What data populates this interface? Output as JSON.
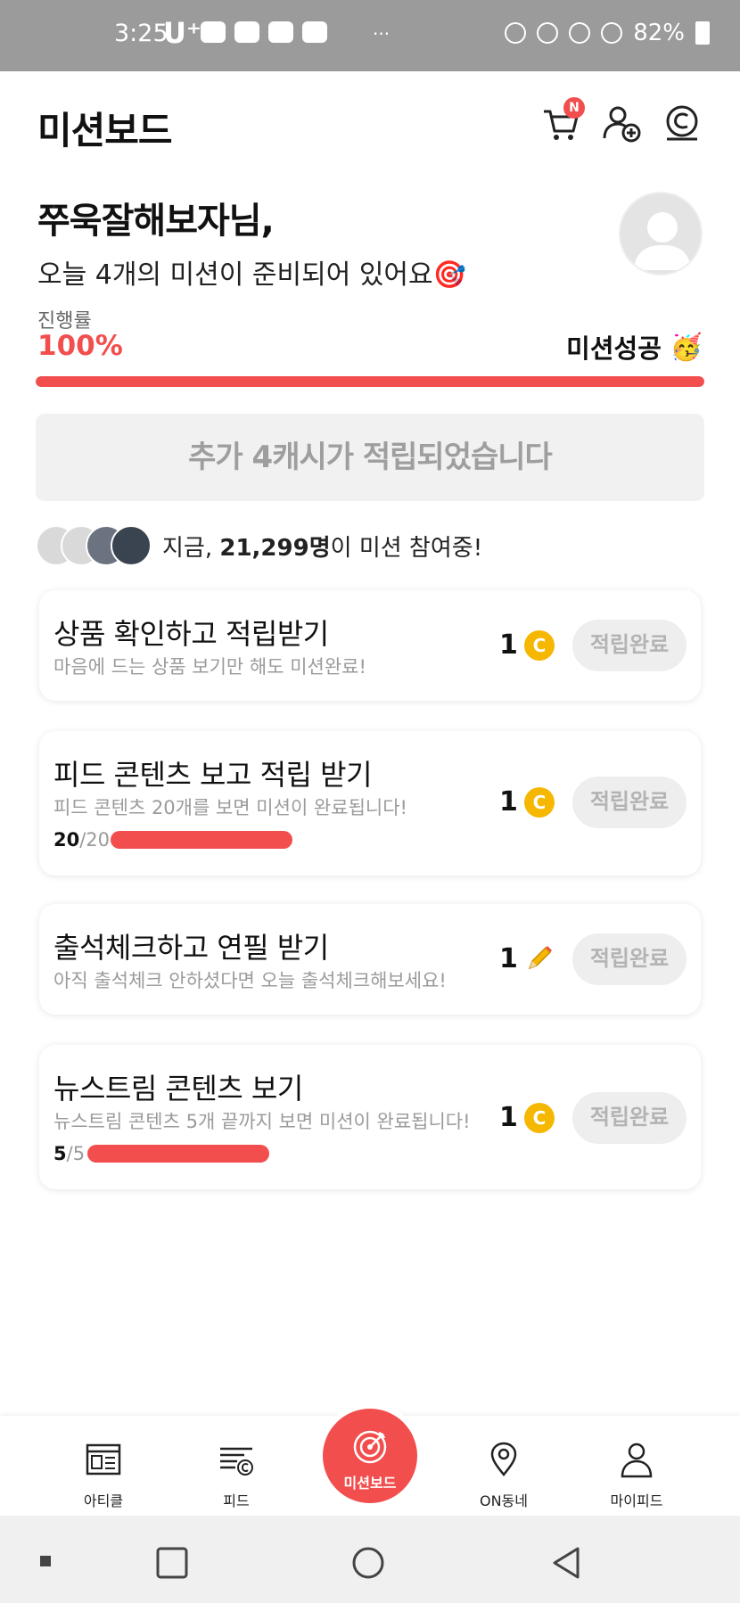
{
  "status_bar": {
    "time": "3:25",
    "carrier": "U⁺",
    "more": "···",
    "battery": "82%"
  },
  "header": {
    "title": "미션보드",
    "cart_badge": "N",
    "icons": [
      "cart-icon",
      "add-friend-icon",
      "cash-coin-icon"
    ]
  },
  "greeting": {
    "name": "쭈욱잘해보자님,",
    "subtitle": "오늘 4개의 미션이 준비되어 있어요",
    "subtitle_emoji": "🎯"
  },
  "progress": {
    "label": "진행률",
    "value": "100%",
    "fraction": 1.0,
    "status": "미션성공",
    "status_emoji": "🥳",
    "color": "#f24e4e"
  },
  "banner": {
    "text": "추가 4캐시가 적립되었습니다"
  },
  "participants": {
    "prefix": "지금, ",
    "count": "21,299명",
    "suffix": "이 미션 참여중!"
  },
  "missions": [
    {
      "title": "상품 확인하고 적립받기",
      "desc": "마음에 드는 상품 보기만 해도 미션완료!",
      "reward": "1",
      "reward_icon": "coin-icon",
      "button": "적립완료"
    },
    {
      "title": "피드 콘텐츠 보고 적립 받기",
      "desc": "피드 콘텐츠 20개를 보면 미션이 완료됩니다!",
      "progress_done": "20",
      "progress_total": "/20",
      "progress_fraction": 1.0,
      "reward": "1",
      "reward_icon": "coin-icon",
      "button": "적립완료"
    },
    {
      "title": "출석체크하고 연필 받기",
      "desc": "아직 출석체크 안하셨다면 오늘 출석체크해보세요!",
      "reward": "1",
      "reward_icon": "pencil-icon",
      "button": "적립완료"
    },
    {
      "title": "뉴스트림 콘텐츠 보기",
      "desc": "뉴스트림 콘텐츠 5개 끝까지 보면 미션이 완료됩니다!",
      "progress_done": "5",
      "progress_total": "/5",
      "progress_fraction": 1.0,
      "reward": "1",
      "reward_icon": "coin-icon",
      "button": "적립완료"
    }
  ],
  "coin_symbol": "C",
  "bottom_nav": {
    "items": [
      {
        "label": "아티클",
        "icon": "article-icon"
      },
      {
        "label": "피드",
        "icon": "feed-icon"
      },
      {
        "label": "미션보드",
        "icon": "target-icon",
        "active": true
      },
      {
        "label": "ON동네",
        "icon": "location-pin-icon"
      },
      {
        "label": "마이피드",
        "icon": "profile-icon"
      }
    ]
  }
}
